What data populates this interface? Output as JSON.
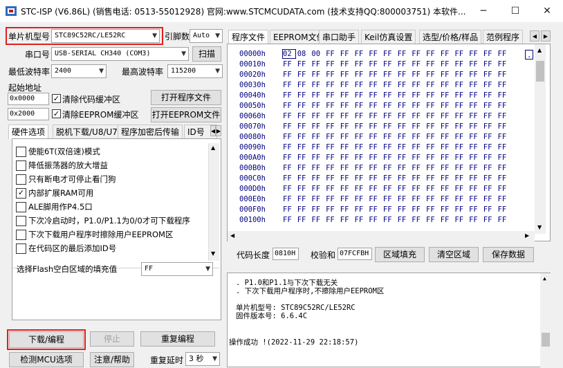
{
  "window": {
    "title": "STC-ISP (V6.86L) (销售电话: 0513-55012928) 官网:www.STCMCUDATA.com  (技术支持QQ:800003751) 本软件...",
    "minimize": "─",
    "maximize": "☐",
    "close": "✕"
  },
  "left": {
    "mcu_label": "单片机型号",
    "mcu_value": "STC89C52RC/LE52RC",
    "pin_label": "引脚数",
    "pin_value": "Auto",
    "port_label": "串口号",
    "port_value": "USB-SERIAL CH340 (COM3)",
    "scan_button": "扫描",
    "min_baud_label": "最低波特率",
    "min_baud_value": "2400",
    "max_baud_label": "最高波特率",
    "max_baud_value": "115200",
    "start_addr_label": "起始地址",
    "addr1": "0x0000",
    "clear_code_label": "清除代码缓冲区",
    "open_prog_button": "打开程序文件",
    "addr2": "0x2000",
    "clear_eeprom_label": "清除EEPROM缓冲区",
    "open_eeprom_button": "打开EEPROM文件",
    "tabs": [
      "硬件选项",
      "脱机下载/U8/U7",
      "程序加密后传输",
      "ID号"
    ],
    "options": [
      {
        "label": "使能6T(双倍速)模式",
        "checked": false
      },
      {
        "label": "降低振荡器的放大增益",
        "checked": false
      },
      {
        "label": "只有断电才可停止看门狗",
        "checked": false
      },
      {
        "label": "内部扩展RAM可用",
        "checked": true
      },
      {
        "label": "ALE脚用作P4.5口",
        "checked": false
      },
      {
        "label": "下次冷启动时，P1.0/P1.1为0/0才可下载程序",
        "checked": false
      },
      {
        "label": "下次下载用户程序时擦除用户EEPROM区",
        "checked": false
      },
      {
        "label": "在代码区的最后添加ID号",
        "checked": false
      }
    ],
    "fill_label": "选择Flash空白区域的填充值",
    "fill_value": "FF",
    "download_button": "下载/编程",
    "stop_button": "停止",
    "reprogram_button": "重复编程",
    "detect_button": "检测MCU选项",
    "help_button": "注意/帮助",
    "delay_label": "重复延时",
    "delay_value": "3 秒"
  },
  "right": {
    "tabs": [
      "程序文件",
      "EEPROM文件",
      "串口助手",
      "Keil仿真设置",
      "选型/价格/样品",
      "范例程序"
    ],
    "hex_rows": [
      {
        "addr": "00000h",
        "bytes": [
          "02",
          "08",
          "00",
          "FF",
          "FF",
          "FF",
          "FF",
          "FF",
          "FF",
          "FF",
          "FF",
          "FF",
          "FF",
          "FF",
          "FF",
          "FF"
        ]
      },
      {
        "addr": "00010h",
        "bytes": [
          "FF",
          "FF",
          "FF",
          "FF",
          "FF",
          "FF",
          "FF",
          "FF",
          "FF",
          "FF",
          "FF",
          "FF",
          "FF",
          "FF",
          "FF",
          "FF"
        ]
      },
      {
        "addr": "00020h",
        "bytes": [
          "FF",
          "FF",
          "FF",
          "FF",
          "FF",
          "FF",
          "FF",
          "FF",
          "FF",
          "FF",
          "FF",
          "FF",
          "FF",
          "FF",
          "FF",
          "FF"
        ]
      },
      {
        "addr": "00030h",
        "bytes": [
          "FF",
          "FF",
          "FF",
          "FF",
          "FF",
          "FF",
          "FF",
          "FF",
          "FF",
          "FF",
          "FF",
          "FF",
          "FF",
          "FF",
          "FF",
          "FF"
        ]
      },
      {
        "addr": "00040h",
        "bytes": [
          "FF",
          "FF",
          "FF",
          "FF",
          "FF",
          "FF",
          "FF",
          "FF",
          "FF",
          "FF",
          "FF",
          "FF",
          "FF",
          "FF",
          "FF",
          "FF"
        ]
      },
      {
        "addr": "00050h",
        "bytes": [
          "FF",
          "FF",
          "FF",
          "FF",
          "FF",
          "FF",
          "FF",
          "FF",
          "FF",
          "FF",
          "FF",
          "FF",
          "FF",
          "FF",
          "FF",
          "FF"
        ]
      },
      {
        "addr": "00060h",
        "bytes": [
          "FF",
          "FF",
          "FF",
          "FF",
          "FF",
          "FF",
          "FF",
          "FF",
          "FF",
          "FF",
          "FF",
          "FF",
          "FF",
          "FF",
          "FF",
          "FF"
        ]
      },
      {
        "addr": "00070h",
        "bytes": [
          "FF",
          "FF",
          "FF",
          "FF",
          "FF",
          "FF",
          "FF",
          "FF",
          "FF",
          "FF",
          "FF",
          "FF",
          "FF",
          "FF",
          "FF",
          "FF"
        ]
      },
      {
        "addr": "00080h",
        "bytes": [
          "FF",
          "FF",
          "FF",
          "FF",
          "FF",
          "FF",
          "FF",
          "FF",
          "FF",
          "FF",
          "FF",
          "FF",
          "FF",
          "FF",
          "FF",
          "FF"
        ]
      },
      {
        "addr": "00090h",
        "bytes": [
          "FF",
          "FF",
          "FF",
          "FF",
          "FF",
          "FF",
          "FF",
          "FF",
          "FF",
          "FF",
          "FF",
          "FF",
          "FF",
          "FF",
          "FF",
          "FF"
        ]
      },
      {
        "addr": "000A0h",
        "bytes": [
          "FF",
          "FF",
          "FF",
          "FF",
          "FF",
          "FF",
          "FF",
          "FF",
          "FF",
          "FF",
          "FF",
          "FF",
          "FF",
          "FF",
          "FF",
          "FF"
        ]
      },
      {
        "addr": "000B0h",
        "bytes": [
          "FF",
          "FF",
          "FF",
          "FF",
          "FF",
          "FF",
          "FF",
          "FF",
          "FF",
          "FF",
          "FF",
          "FF",
          "FF",
          "FF",
          "FF",
          "FF"
        ]
      },
      {
        "addr": "000C0h",
        "bytes": [
          "FF",
          "FF",
          "FF",
          "FF",
          "FF",
          "FF",
          "FF",
          "FF",
          "FF",
          "FF",
          "FF",
          "FF",
          "FF",
          "FF",
          "FF",
          "FF"
        ]
      },
      {
        "addr": "000D0h",
        "bytes": [
          "FF",
          "FF",
          "FF",
          "FF",
          "FF",
          "FF",
          "FF",
          "FF",
          "FF",
          "FF",
          "FF",
          "FF",
          "FF",
          "FF",
          "FF",
          "FF"
        ]
      },
      {
        "addr": "000E0h",
        "bytes": [
          "FF",
          "FF",
          "FF",
          "FF",
          "FF",
          "FF",
          "FF",
          "FF",
          "FF",
          "FF",
          "FF",
          "FF",
          "FF",
          "FF",
          "FF",
          "FF"
        ]
      },
      {
        "addr": "000F0h",
        "bytes": [
          "FF",
          "FF",
          "FF",
          "FF",
          "FF",
          "FF",
          "FF",
          "FF",
          "FF",
          "FF",
          "FF",
          "FF",
          "FF",
          "FF",
          "FF",
          "FF"
        ]
      },
      {
        "addr": "00100h",
        "bytes": [
          "FF",
          "FF",
          "FF",
          "FF",
          "FF",
          "FF",
          "FF",
          "FF",
          "FF",
          "FF",
          "FF",
          "FF",
          "FF",
          "FF",
          "FF",
          "FF"
        ]
      }
    ],
    "ascii_first": ".",
    "code_len_label": "代码长度",
    "code_len_value": "0810H",
    "checksum_label": "校验和",
    "checksum_value": "07FCFBH",
    "fill_area_button": "区域填充",
    "clear_area_button": "清空区域",
    "save_button": "保存数据",
    "log_lines": [
      ". P1.0和P1.1与下次下载无关",
      ". 下次下载用户程序时,不擦除用户EEPROM区",
      "",
      "单片机型号: STC89C52RC/LE52RC",
      "固件版本号: 6.6.4C",
      "",
      "",
      "操作成功 !(2022-11-29 22:18:57)"
    ]
  },
  "colors": {
    "highlight_red": "#e0201c",
    "hex_text": "#000080"
  }
}
